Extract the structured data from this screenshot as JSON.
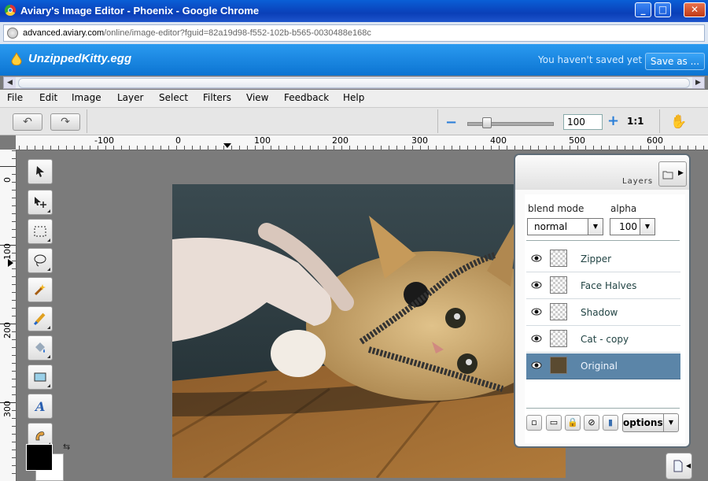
{
  "window": {
    "title": "Aviary's Image Editor - Phoenix - Google Chrome"
  },
  "address": {
    "host": "advanced.aviary.com",
    "path": "/online/image-editor?fguid=82a19d98-f552-102b-b565-0030488e168c"
  },
  "app": {
    "doc_title": "UnzippedKitty.egg",
    "save_status": "You haven't saved yet",
    "save_as_label": "Save as ..."
  },
  "menu": [
    "File",
    "Edit",
    "Image",
    "Layer",
    "Select",
    "Filters",
    "View",
    "Feedback",
    "Help"
  ],
  "toolbar": {
    "zoom_value": "100",
    "zoom_level": 0.2,
    "actual_size_label": "1:1"
  },
  "ruler": {
    "h_labels": [
      "-100",
      "0",
      "100",
      "200",
      "300",
      "400",
      "500",
      "600"
    ],
    "v_labels": [
      "0",
      "100",
      "200",
      "300"
    ]
  },
  "tools": [
    "arrow-select",
    "move",
    "marquee",
    "lasso",
    "magic-wand",
    "brush",
    "fill",
    "shape",
    "text",
    "smudge"
  ],
  "colors": {
    "foreground": "#000000",
    "background": "#ffffff",
    "accent": "#1a86e0",
    "selected_layer": "#5b85a8"
  },
  "layers_panel": {
    "title": "Layers",
    "blend_label": "blend mode",
    "blend_value": "normal",
    "alpha_label": "alpha",
    "alpha_value": "100",
    "layers": [
      {
        "name": "Zipper",
        "selected": false
      },
      {
        "name": "Face Halves",
        "selected": false
      },
      {
        "name": "Shadow",
        "selected": false
      },
      {
        "name": "Cat - copy",
        "selected": false
      },
      {
        "name": "Original",
        "selected": true
      }
    ],
    "options_label": "options"
  }
}
